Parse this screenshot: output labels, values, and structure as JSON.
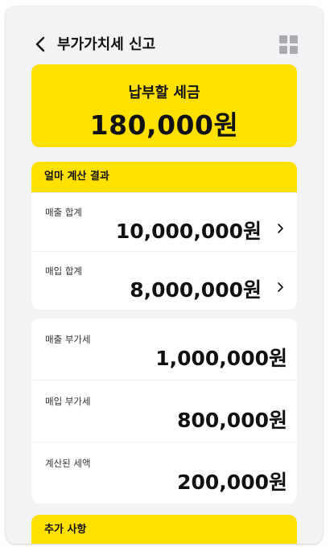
{
  "header": {
    "title": "부가가치세 신고",
    "back_icon": "chevron-left-icon",
    "menu_icon": "grid-icon"
  },
  "banner": {
    "label": "납부할 세금",
    "amount": "180,000원",
    "color": "#ffe100"
  },
  "summary": {
    "heading": "얼마 계산 결과",
    "rows": [
      {
        "label": "매출 합계",
        "value": "10,000,000원"
      },
      {
        "label": "매입 합계",
        "value": "8,000,000원"
      }
    ]
  },
  "tax": {
    "rows": [
      {
        "label": "매출 부가세",
        "value": "1,000,000원"
      },
      {
        "label": "매입 부가세",
        "value": "800,000원"
      },
      {
        "label": "계산된 세액",
        "value": "200,000원"
      }
    ]
  },
  "extra": {
    "heading": "추가 사항"
  },
  "colors": {
    "accent": "#ffe100",
    "background": "#f2f3f5",
    "text": "#111111"
  }
}
